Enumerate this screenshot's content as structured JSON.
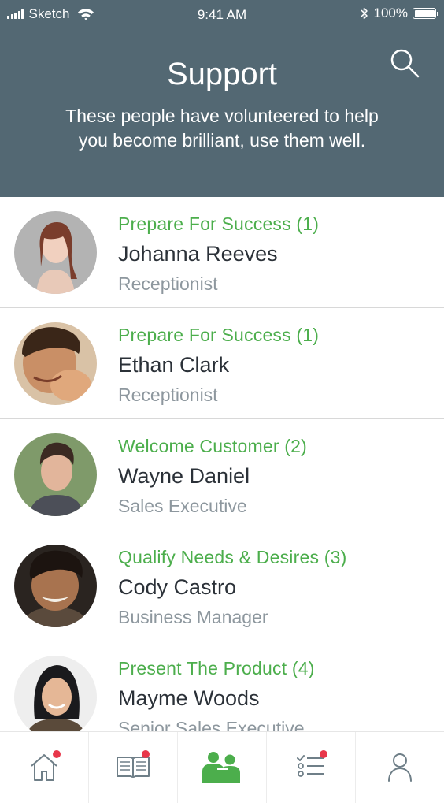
{
  "status_bar": {
    "carrier": "Sketch",
    "time": "9:41 AM",
    "battery": "100%"
  },
  "header": {
    "title": "Support",
    "subtitle_line1": "These people have volunteered to help",
    "subtitle_line2": "you become brilliant, use them well."
  },
  "people": [
    {
      "course": "Prepare For Success (1)",
      "name": "Johanna Reeves",
      "role": "Receptionist"
    },
    {
      "course": "Prepare For Success (1)",
      "name": "Ethan Clark",
      "role": "Receptionist"
    },
    {
      "course": "Welcome Customer (2)",
      "name": "Wayne Daniel",
      "role": "Sales Executive"
    },
    {
      "course": "Qualify Needs & Desires (3)",
      "name": "Cody Castro",
      "role": "Business Manager"
    },
    {
      "course": "Present The Product (4)",
      "name": "Mayme Woods",
      "role": "Senior Sales Executive"
    }
  ],
  "tabs": [
    {
      "icon": "home-icon",
      "badge": true,
      "active": false
    },
    {
      "icon": "book-icon",
      "badge": true,
      "active": false
    },
    {
      "icon": "people-icon",
      "badge": false,
      "active": true
    },
    {
      "icon": "checklist-icon",
      "badge": true,
      "active": false
    },
    {
      "icon": "profile-icon",
      "badge": false,
      "active": false
    }
  ],
  "colors": {
    "header_bg": "#536873",
    "accent_green": "#4cae4c",
    "name_text": "#2b3138",
    "role_text": "#8d979e",
    "icon_gray": "#6f7f88",
    "badge_red": "#e8374a"
  }
}
